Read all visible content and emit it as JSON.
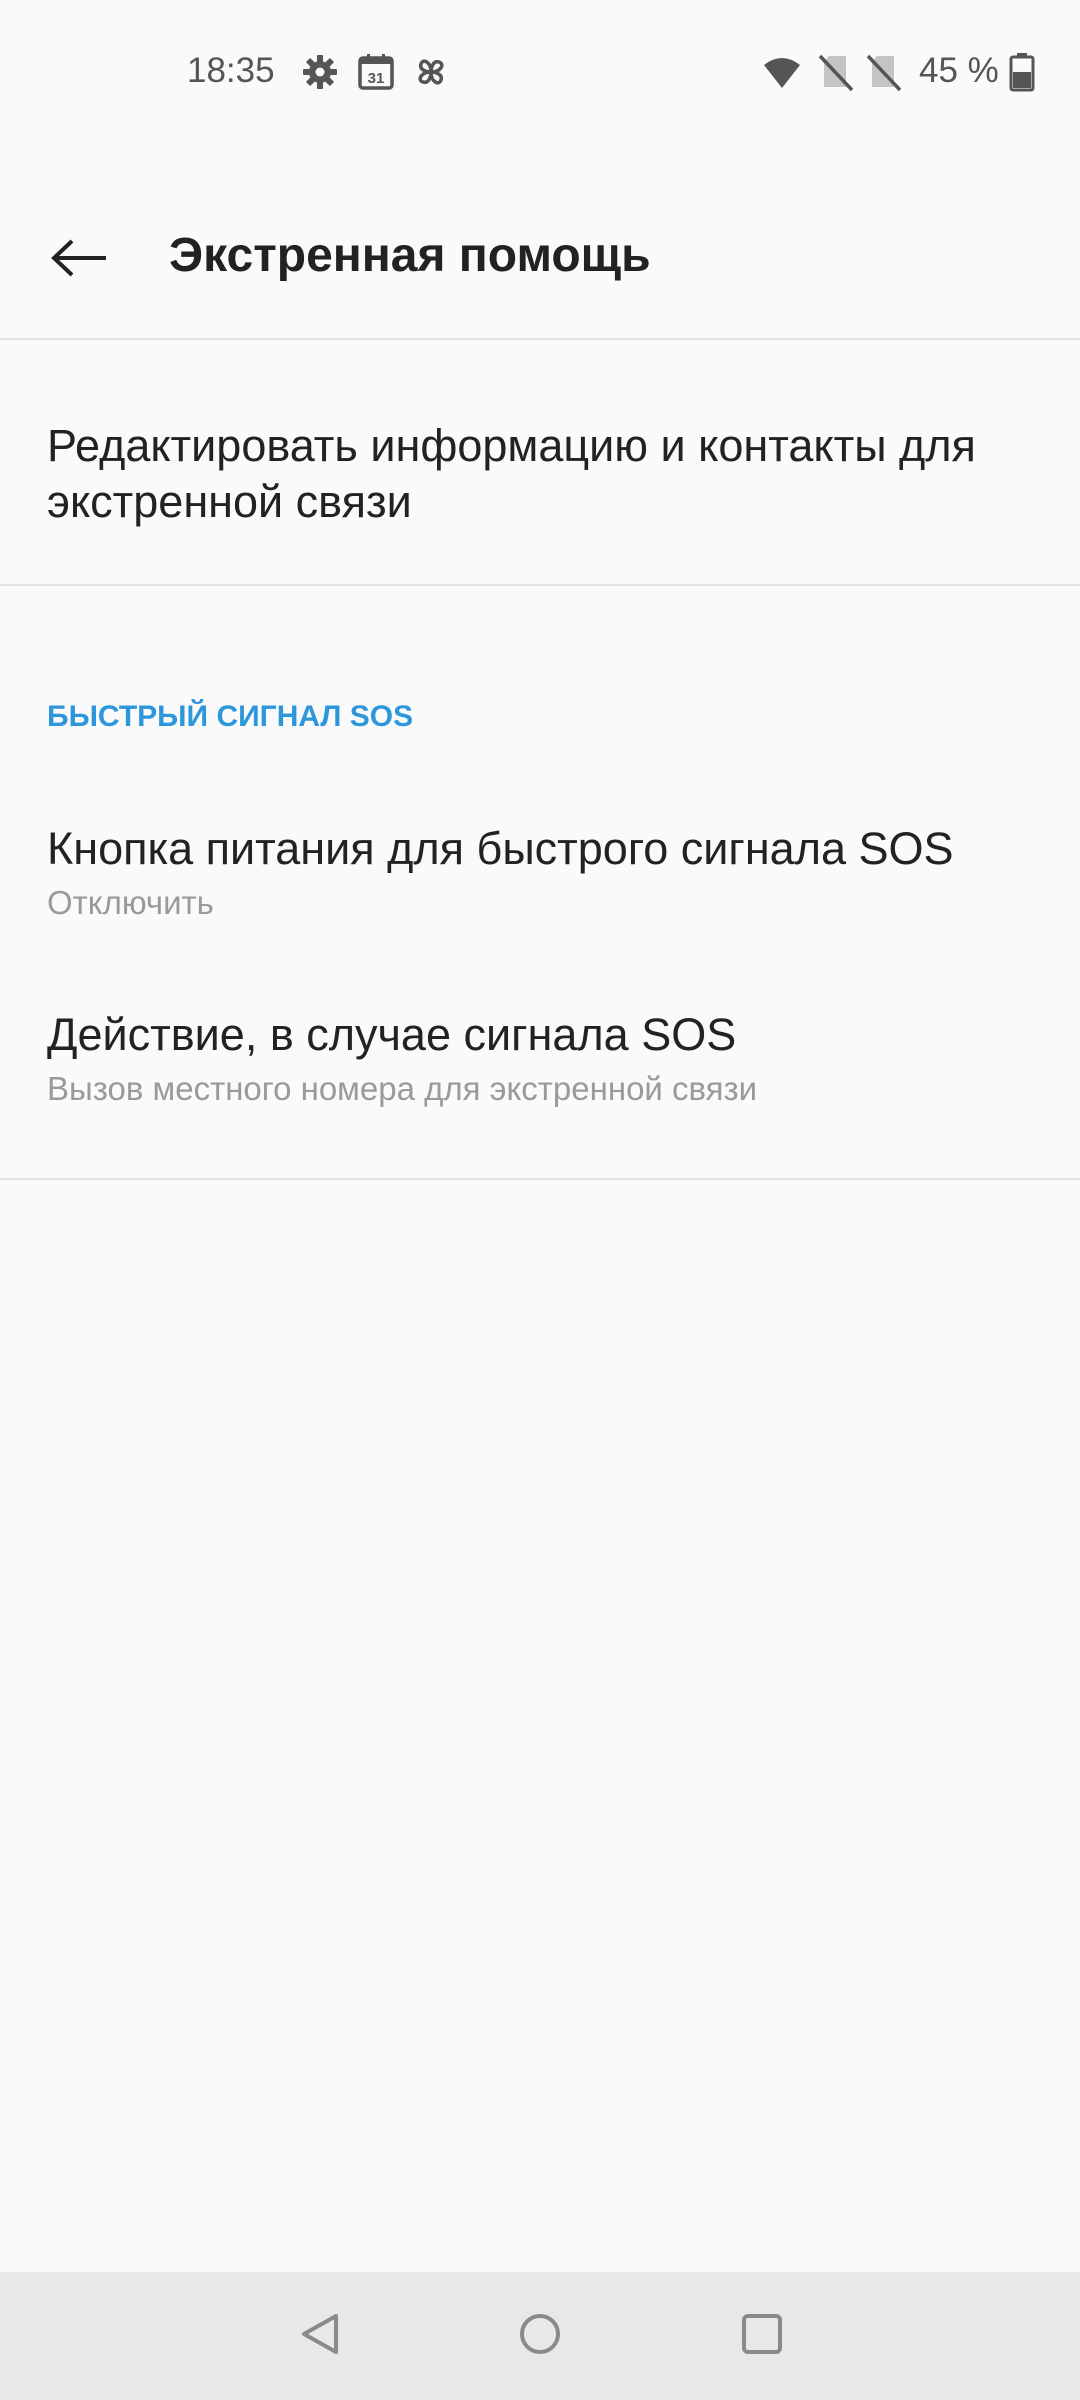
{
  "status_bar": {
    "time": "18:35",
    "battery": "45 %",
    "icons": [
      "settings-gear-icon",
      "calendar-icon",
      "pinwheel-icon",
      "wifi-icon",
      "no-sim-icon",
      "no-sim-icon",
      "battery-icon"
    ],
    "calendar_day": "31"
  },
  "app_bar": {
    "back_icon": "arrow-left-icon",
    "title": "Экстренная помощь"
  },
  "edit_row": {
    "label": "Редактировать информацию и контакты для экстренной связи"
  },
  "section": {
    "header": "БЫСТРЫЙ СИГНАЛ SOS",
    "items": [
      {
        "title": "Кнопка питания для быстрого сигнала SOS",
        "summary": "Отключить"
      },
      {
        "title": "Действие, в случае сигнала SOS",
        "summary": "Вызов местного номера для экстренной связи"
      }
    ]
  },
  "nav_bar": {
    "icons": [
      "nav-back-icon",
      "nav-home-icon",
      "nav-recents-icon"
    ]
  },
  "colors": {
    "background": "#fafafa",
    "accent": "#2e97db",
    "text_primary": "#222222",
    "text_secondary": "#9a9a9a",
    "divider": "#e2e2e2",
    "nav_background": "#e8e8e8"
  }
}
